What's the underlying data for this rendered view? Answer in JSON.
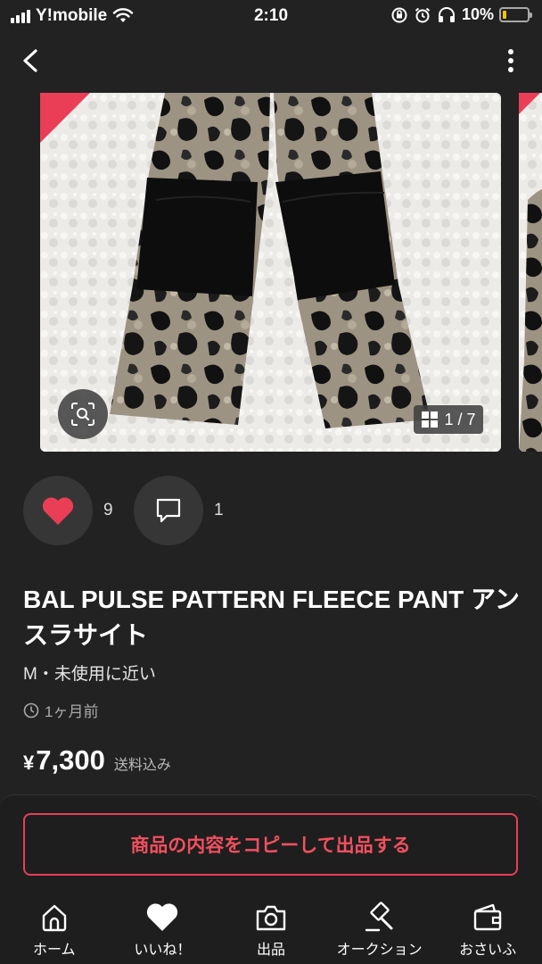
{
  "status_bar": {
    "carrier": "Y!mobile",
    "time": "2:10",
    "battery": "10%"
  },
  "carousel": {
    "counter": "1 / 7"
  },
  "actions": {
    "likes": "9",
    "comments": "1"
  },
  "item": {
    "title": "BAL PULSE PATTERN FLEECE PANT アンスラサイト",
    "condition": "M・未使用に近い",
    "posted": "1ヶ月前",
    "currency": "¥",
    "price": "7,300",
    "shipping": "送料込み"
  },
  "copy_button": "商品の内容をコピーして出品する",
  "tabbar": [
    {
      "label": "ホーム",
      "icon": "home-icon"
    },
    {
      "label": "いいね！",
      "icon": "heart-icon"
    },
    {
      "label": "出品",
      "icon": "camera-icon"
    },
    {
      "label": "オークション",
      "icon": "gavel-icon"
    },
    {
      "label": "おさいふ",
      "icon": "wallet-icon"
    }
  ],
  "colors": {
    "accent": "#ea3e57",
    "background": "#222222",
    "battery_low": "#f5c400"
  }
}
